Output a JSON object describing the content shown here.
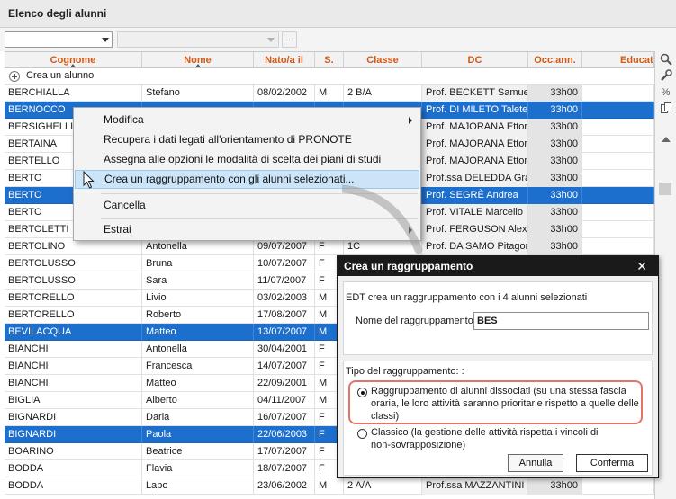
{
  "window": {
    "title": "Elenco degli alunni"
  },
  "filters": {
    "combo1_value": "",
    "combo2_value": "",
    "more_label": "..."
  },
  "columns": [
    "Cognome",
    "Nome",
    "Nato/a il",
    "S.",
    "Classe",
    "DC",
    "Occ.ann.",
    "Educat"
  ],
  "create_row_label": "Crea un alunno",
  "rows": [
    {
      "cognome": "BERCHIALLA",
      "nome": "Stefano",
      "nato": "08/02/2002",
      "s": "M",
      "classe": "2 B/A",
      "dc": "Prof. BECKETT Samuel",
      "occ": "33h00",
      "selected": false
    },
    {
      "cognome": "BERNOCCO",
      "nome": "",
      "nato": "",
      "s": "",
      "classe": "",
      "dc": "Prof. DI MILETO Talete",
      "occ": "33h00",
      "selected": true
    },
    {
      "cognome": "BERSIGHELLI",
      "nome": "",
      "nato": "",
      "s": "",
      "classe": "",
      "dc": "Prof. MAJORANA Ettore",
      "occ": "33h00",
      "selected": false
    },
    {
      "cognome": "BERTAINA",
      "nome": "",
      "nato": "",
      "s": "",
      "classe": "",
      "dc": "Prof. MAJORANA Ettore",
      "occ": "33h00",
      "selected": false
    },
    {
      "cognome": "BERTELLO",
      "nome": "",
      "nato": "",
      "s": "",
      "classe": "",
      "dc": "Prof. MAJORANA Ettore",
      "occ": "33h00",
      "selected": false
    },
    {
      "cognome": "BERTO",
      "nome": "",
      "nato": "",
      "s": "",
      "classe": "",
      "dc": "Prof.ssa DELEDDA Grazia",
      "occ": "33h00",
      "selected": false
    },
    {
      "cognome": "BERTO",
      "nome": "",
      "nato": "",
      "s": "",
      "classe": "",
      "dc": "Prof. SEGRÈ Andrea",
      "occ": "33h00",
      "selected": true
    },
    {
      "cognome": "BERTO",
      "nome": "",
      "nato": "",
      "s": "",
      "classe": "",
      "dc": "Prof. VITALE Marcello",
      "occ": "33h00",
      "selected": false
    },
    {
      "cognome": "BERTOLETTI",
      "nome": "",
      "nato": "",
      "s": "",
      "classe": "",
      "dc": "Prof. FERGUSON Alex",
      "occ": "33h00",
      "selected": false
    },
    {
      "cognome": "BERTOLINO",
      "nome": "Antonella",
      "nato": "09/07/2007",
      "s": "F",
      "classe": "1C",
      "dc": "Prof. DA SAMO Pitagora",
      "occ": "33h00",
      "selected": false
    },
    {
      "cognome": "BERTOLUSSO",
      "nome": "Bruna",
      "nato": "10/07/2007",
      "s": "F",
      "classe": "",
      "dc": "",
      "occ": "",
      "selected": false
    },
    {
      "cognome": "BERTOLUSSO",
      "nome": "Sara",
      "nato": "11/07/2007",
      "s": "F",
      "classe": "",
      "dc": "",
      "occ": "",
      "selected": false
    },
    {
      "cognome": "BERTORELLO",
      "nome": "Livio",
      "nato": "03/02/2003",
      "s": "M",
      "classe": "",
      "dc": "",
      "occ": "",
      "selected": false
    },
    {
      "cognome": "BERTORELLO",
      "nome": "Roberto",
      "nato": "17/08/2007",
      "s": "M",
      "classe": "",
      "dc": "",
      "occ": "",
      "selected": false
    },
    {
      "cognome": "BEVILACQUA",
      "nome": "Matteo",
      "nato": "13/07/2007",
      "s": "M",
      "classe": "",
      "dc": "",
      "occ": "",
      "selected": true
    },
    {
      "cognome": "BIANCHI",
      "nome": "Antonella",
      "nato": "30/04/2001",
      "s": "F",
      "classe": "",
      "dc": "",
      "occ": "",
      "selected": false
    },
    {
      "cognome": "BIANCHI",
      "nome": "Francesca",
      "nato": "14/07/2007",
      "s": "F",
      "classe": "",
      "dc": "",
      "occ": "",
      "selected": false
    },
    {
      "cognome": "BIANCHI",
      "nome": "Matteo",
      "nato": "22/09/2001",
      "s": "M",
      "classe": "",
      "dc": "",
      "occ": "",
      "selected": false
    },
    {
      "cognome": "BIGLIA",
      "nome": "Alberto",
      "nato": "04/11/2007",
      "s": "M",
      "classe": "",
      "dc": "",
      "occ": "",
      "selected": false
    },
    {
      "cognome": "BIGNARDI",
      "nome": "Daria",
      "nato": "16/07/2007",
      "s": "F",
      "classe": "",
      "dc": "",
      "occ": "",
      "selected": false
    },
    {
      "cognome": "BIGNARDI",
      "nome": "Paola",
      "nato": "22/06/2003",
      "s": "F",
      "classe": "",
      "dc": "",
      "occ": "",
      "selected": true
    },
    {
      "cognome": "BOARINO",
      "nome": "Beatrice",
      "nato": "17/07/2007",
      "s": "F",
      "classe": "",
      "dc": "",
      "occ": "",
      "selected": false
    },
    {
      "cognome": "BODDA",
      "nome": "Flavia",
      "nato": "18/07/2007",
      "s": "F",
      "classe": "",
      "dc": "",
      "occ": "",
      "selected": false
    },
    {
      "cognome": "BODDA",
      "nome": "Lapo",
      "nato": "23/06/2002",
      "s": "M",
      "classe": "2 A/A",
      "dc": "Prof.ssa MAZZANTINI",
      "occ": "33h00",
      "selected": false
    }
  ],
  "sidebar": {
    "icons": [
      "search-icon",
      "wrench-icon",
      "percent-icon",
      "copy-icon",
      "scroll-up-icon"
    ],
    "percent_glyph": "%"
  },
  "context_menu": {
    "items": [
      {
        "label": "Modifica",
        "submenu": true
      },
      {
        "label": "Recupera i dati legati all'orientamento di PRONOTE",
        "submenu": false
      },
      {
        "label": "Assegna alle opzioni le modalità di scelta dei piani di studi",
        "submenu": false
      },
      {
        "label": "Crea un raggruppamento con gli alunni selezionati...",
        "submenu": false,
        "highlighted": true
      },
      {
        "label": "Cancella",
        "submenu": false
      },
      {
        "label": "Estrai",
        "submenu": true
      }
    ]
  },
  "dialog": {
    "title": "Crea un raggruppamento",
    "close_glyph": "✕",
    "info": "EDT crea un raggruppamento con i 4 alunni selezionati",
    "name_label": "Nome del raggruppamento :",
    "name_value": "BES",
    "type_label": "Tipo del raggruppamento: :",
    "option1_line1": "Raggruppamento di alunni dissociati (su una stessa fascia",
    "option1_line2": "oraria, le loro attività saranno prioritarie rispetto a quelle delle",
    "option1_line3": "classi)",
    "option2_line1": "Classico (la gestione delle attività rispetta i vincoli di",
    "option2_line2": "non-sovrapposizione)",
    "selected_option": 1,
    "cancel_label": "Annulla",
    "confirm_label": "Conferma"
  },
  "colors": {
    "header_text": "#d05a17",
    "selection": "#1d6fce",
    "highlight_ring": "#e0756a"
  }
}
